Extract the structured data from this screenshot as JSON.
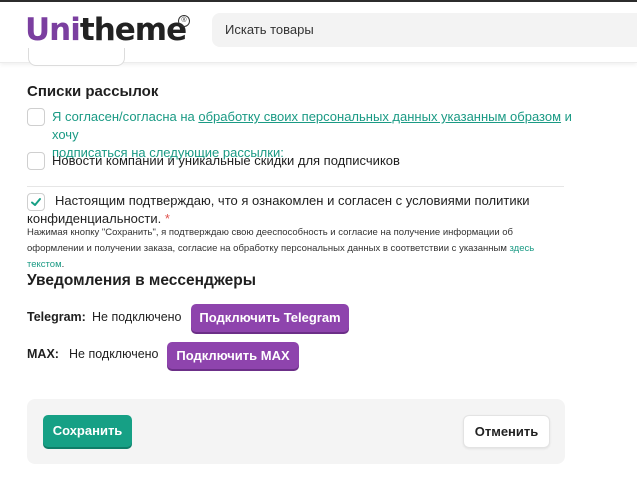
{
  "header": {
    "logo_part1": "Uni",
    "logo_part2": "theme",
    "logo_mark": "®",
    "search_placeholder": "Искать товары"
  },
  "mailing": {
    "title": "Списки рассылок",
    "consent_text_before": "Я согласен/согласна на ",
    "consent_link": "обработку своих персональных данных указанным образом",
    "consent_text_after_line1": " и хочу",
    "consent_text_line2": "подписаться на следующие рассылки:",
    "newsletter_label": "Новости компании и уникальные скидки для подписчиков"
  },
  "privacy": {
    "line1": "Настоящим подтверждаю, что я ознакомлен и согласен с условиями политики",
    "line2": "конфиденциальности.",
    "required_mark": "*",
    "note_line1": "Нажимая кнопку \"Сохранить\", я подтверждаю свою дееспособность и согласие на получение информации об",
    "note_line2": "оформлении и получении заказа, согласие на обработку персональных данных в соответствии с указанным",
    "note_link1": "здесь",
    "note_link2": "текстом",
    "note_end": "."
  },
  "messengers": {
    "title": "Уведомления в мессенджеры",
    "telegram_label": "Telegram:",
    "telegram_status": "Не подключено",
    "telegram_button": "Подключить Telegram",
    "max_label": "MAX:",
    "max_status": "Не подключено",
    "max_button": "Подключить MAX"
  },
  "actions": {
    "save": "Сохранить",
    "cancel": "Отменить"
  },
  "colors": {
    "brand_purple": "#8e44ad",
    "accent_green": "#16a085",
    "link_green": "#1a9a84"
  }
}
